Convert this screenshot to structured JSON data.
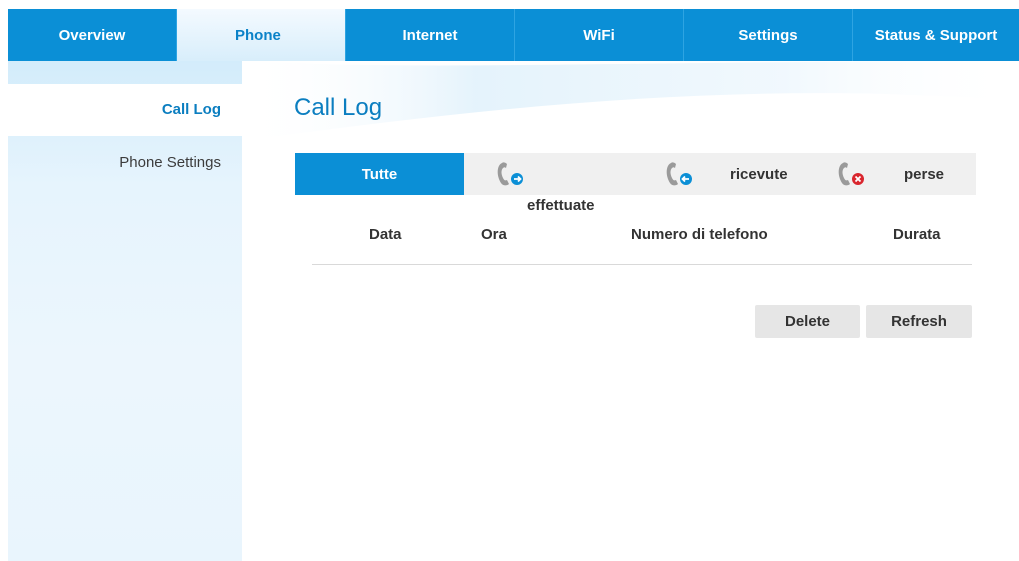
{
  "nav": {
    "tabs": [
      {
        "label": "Overview"
      },
      {
        "label": "Phone"
      },
      {
        "label": "Internet"
      },
      {
        "label": "WiFi"
      },
      {
        "label": "Settings"
      },
      {
        "label": "Status & Support"
      }
    ],
    "active": "Phone"
  },
  "sidebar": {
    "items": [
      {
        "label": "Call Log"
      },
      {
        "label": "Phone Settings"
      }
    ]
  },
  "main": {
    "title": "Call Log",
    "filters": {
      "all": "Tutte",
      "outgoing": "effettuate",
      "incoming": "ricevute",
      "missed": "perse"
    },
    "columns": [
      "Data",
      "Ora",
      "Numero di telefono",
      "Durata"
    ],
    "buttons": {
      "delete": "Delete",
      "refresh": "Refresh"
    }
  },
  "colors": {
    "brand_blue": "#0b8fd6",
    "title_blue": "#0b7ec0",
    "missed_red": "#d9262e"
  },
  "icons": [
    "phone-outgoing-icon",
    "phone-incoming-icon",
    "phone-missed-icon"
  ]
}
